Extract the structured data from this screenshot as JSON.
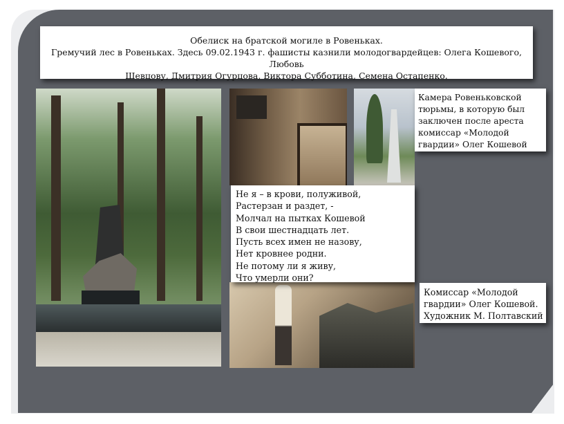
{
  "title": {
    "line1": "Обелиск на братской могиле в Ровеньках.",
    "line2": "Гремучий лес в Ровеньках. Здесь 09.02.1943 г. фашисты казнили молодогвардейцев: Олега Кошевого, Любовь",
    "line3": "Шевцову, Дмитрия Огурцова, Виктора Субботина, Семена Остапенко."
  },
  "poem": [
    "Не я – в крови, полуживой,",
    "Растерзан и раздет, -",
    "Молчал на пытках Кошевой",
    "В свои шестнадцать лет.",
    "Пусть всех имен не назову,",
    "Нет кровнее родни.",
    "Не потому ли я живу,",
    "Что умерли они?"
  ],
  "caption_cell": [
    "Камера Ровеньковской",
    "тюрьмы, в которую был",
    "заключен после ареста",
    "комиссар «Молодой",
    "гвардии» Олег Кошевой"
  ],
  "caption_painting": [
    "Комиссар «Молодой",
    "гвардии» Олег Кошевой.",
    "Художник М. Полтавский"
  ]
}
